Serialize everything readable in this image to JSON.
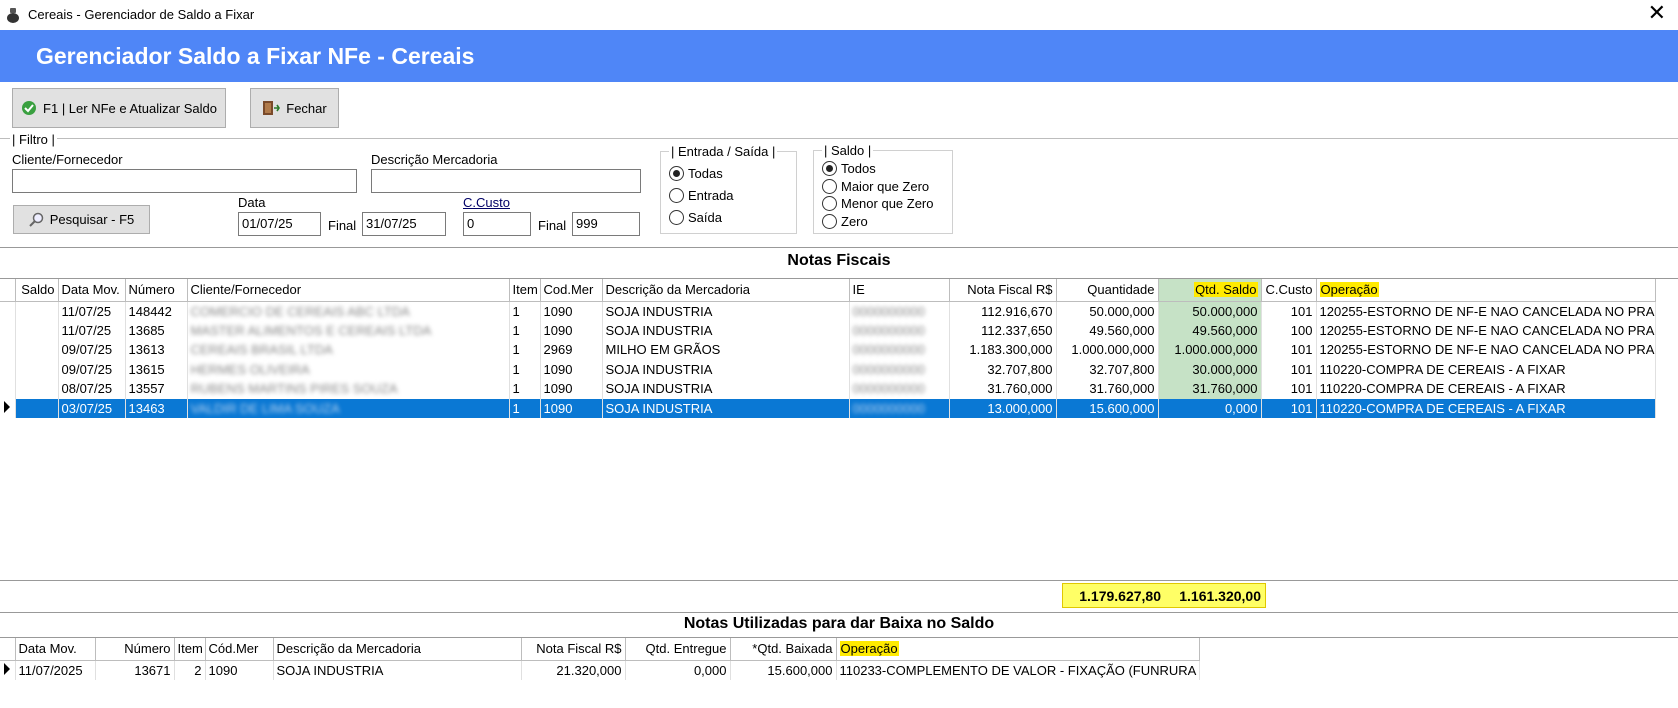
{
  "window": {
    "title": "Cereais - Gerenciador de Saldo a Fixar",
    "close_glyph": "✕"
  },
  "banner": {
    "title": "Gerenciador Saldo a Fixar NFe - Cereais"
  },
  "toolbar": {
    "read_label": "F1 | Ler NFe e Atualizar Saldo",
    "close_label": "Fechar"
  },
  "filter": {
    "group_label": "Filtro",
    "client_label": "Cliente/Fornecedor",
    "client_value": "",
    "desc_label": "Descrição Mercadoria",
    "desc_value": "",
    "search_label": "Pesquisar - F5",
    "date_label": "Data",
    "date_start": "01/07/25",
    "final_label": "Final",
    "date_end": "31/07/25",
    "ccusto_label": "C.Custo",
    "ccusto_start": "0",
    "ccusto_final_label": "Final",
    "ccusto_end": "999"
  },
  "entrada_saida": {
    "label": "Entrada / Saída",
    "options": [
      "Todas",
      "Entrada",
      "Saída"
    ],
    "selected": "Todas"
  },
  "saldo": {
    "label": "Saldo",
    "options": [
      "Todos",
      "Maior que Zero",
      "Menor que Zero",
      "Zero"
    ],
    "selected": "Todos"
  },
  "notas": {
    "title": "Notas Fiscais",
    "columns": [
      "Saldo",
      "Data Mov.",
      "Número",
      "Cliente/Fornecedor",
      "Item",
      "Cod.Mer",
      "Descrição da Mercadoria",
      "IE",
      "Nota Fiscal R$",
      "Quantidade",
      "Qtd. Saldo",
      "C.Custo",
      "Operação"
    ],
    "rows": [
      {
        "data": "11/07/25",
        "numero": "148442",
        "cliente": "COMERCIO DE CEREAIS ABC LTDA",
        "item": "1",
        "codmer": "1090",
        "descricao": "SOJA INDUSTRIA",
        "ie": "0000000000",
        "nf": "112.916,670",
        "qtd": "50.000,000",
        "saldo": "50.000,000",
        "ccusto": "101",
        "operacao": "120255-ESTORNO DE NF-E NAO CANCELADA NO PRA"
      },
      {
        "data": "11/07/25",
        "numero": "13685",
        "cliente": "MASTER ALIMENTOS E CEREAIS LTDA",
        "item": "1",
        "codmer": "1090",
        "descricao": "SOJA INDUSTRIA",
        "ie": "0000000000",
        "nf": "112.337,650",
        "qtd": "49.560,000",
        "saldo": "49.560,000",
        "ccusto": "100",
        "operacao": "120255-ESTORNO DE NF-E NAO CANCELADA NO PRA"
      },
      {
        "data": "09/07/25",
        "numero": "13613",
        "cliente": "CEREAIS BRASIL LTDA",
        "item": "1",
        "codmer": "2969",
        "descricao": "MILHO EM GRÃOS",
        "ie": "0000000000",
        "nf": "1.183.300,000",
        "qtd": "1.000.000,000",
        "saldo": "1.000.000,000",
        "ccusto": "101",
        "operacao": "120255-ESTORNO DE NF-E NAO CANCELADA NO PRA"
      },
      {
        "data": "09/07/25",
        "numero": "13615",
        "cliente": "HERMES OLIVEIRA",
        "item": "1",
        "codmer": "1090",
        "descricao": "SOJA INDUSTRIA",
        "ie": "0000000000",
        "nf": "32.707,800",
        "qtd": "32.707,800",
        "saldo": "30.000,000",
        "ccusto": "101",
        "operacao": "110220-COMPRA DE CEREAIS - A FIXAR"
      },
      {
        "data": "08/07/25",
        "numero": "13557",
        "cliente": "RUBENS MARTINS PIRES SOUZA",
        "item": "1",
        "codmer": "1090",
        "descricao": "SOJA INDUSTRIA",
        "ie": "0000000000",
        "nf": "31.760,000",
        "qtd": "31.760,000",
        "saldo": "31.760,000",
        "ccusto": "101",
        "operacao": "110220-COMPRA DE CEREAIS - A FIXAR"
      },
      {
        "data": "03/07/25",
        "numero": "13463",
        "cliente": "VALDIR DE LIMA SOUZA",
        "item": "1",
        "codmer": "1090",
        "descricao": "SOJA INDUSTRIA",
        "ie": "0000000000",
        "nf": "13.000,000",
        "qtd": "15.600,000",
        "saldo": "0,000",
        "ccusto": "101",
        "operacao": "110220-COMPRA DE CEREAIS - A FIXAR"
      }
    ],
    "selected_row": 5,
    "totals": {
      "nf": "1.179.627,80",
      "qtd": "1.161.320,00"
    }
  },
  "baixa": {
    "title": "Notas Utilizadas para dar Baixa no Saldo",
    "columns": [
      "Data Mov.",
      "Número",
      "Item",
      "Cód.Mer",
      "Descrição da Mercadoria",
      "Nota Fiscal R$",
      "Qtd. Entregue",
      "*Qtd. Baixada",
      "Operação"
    ],
    "rows": [
      {
        "data": "11/07/2025",
        "numero": "13671",
        "item": "2",
        "codmer": "1090",
        "descricao": "SOJA INDUSTRIA",
        "nf": "21.320,000",
        "entregue": "0,000",
        "baixada": "15.600,000",
        "operacao": "110233-COMPLEMENTO DE VALOR - FIXAÇÃO (FUNRURA"
      }
    ]
  },
  "colors": {
    "banner": "#4f86f7",
    "selection": "#0a78d4",
    "saldo_col": "#c6e2c6",
    "highlight": "#ffea00"
  }
}
